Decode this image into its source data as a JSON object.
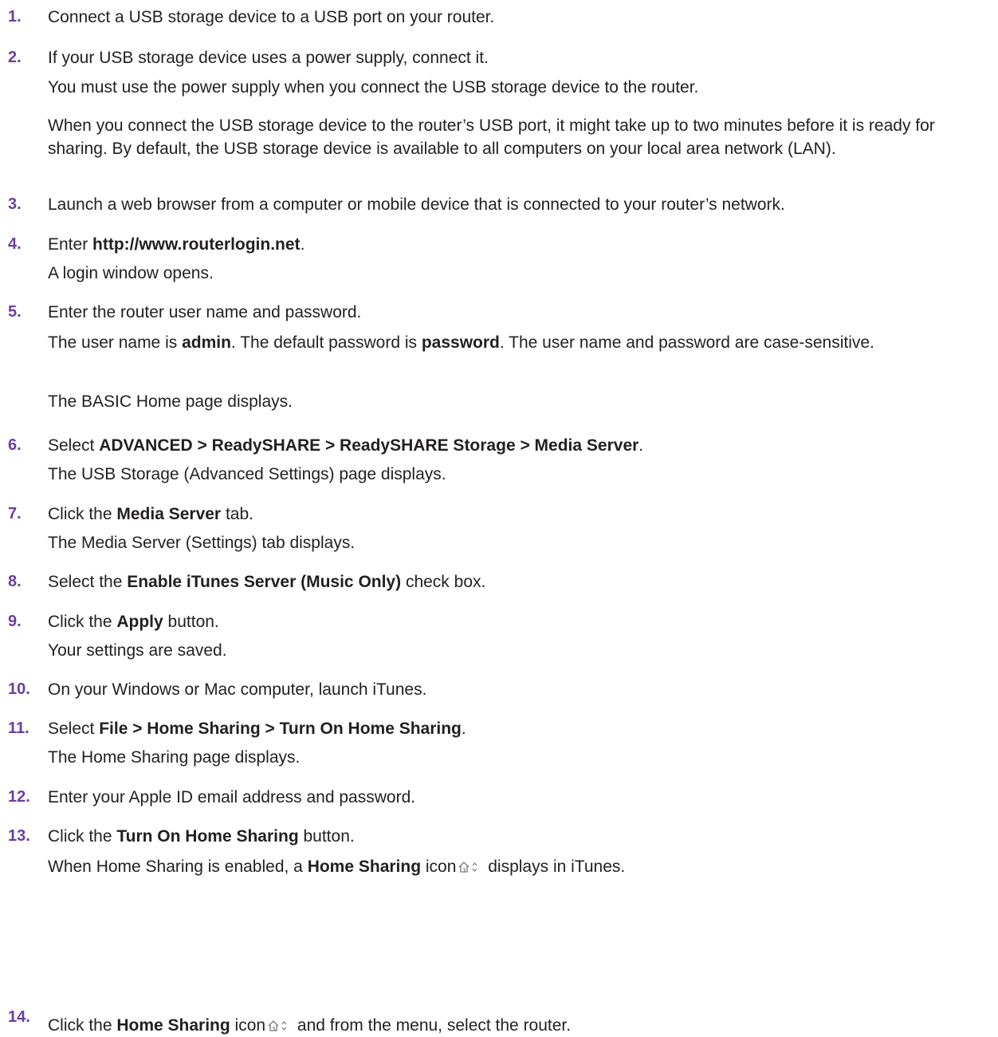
{
  "steps": [
    {
      "number": "1.",
      "text": "Connect a USB storage device to a USB port on your router."
    },
    {
      "number": "2.",
      "text": "If your USB storage device uses a power supply, connect it.",
      "note1": "You must use the power supply when you connect the USB storage device to the router.",
      "note2": "When you connect the USB storage device to the router’s USB port, it might take up to two minutes before it is ready for sharing. By default, the USB storage device is available to all computers on your local area network (LAN)."
    },
    {
      "number": "3.",
      "text": "Launch a web browser from a computer or mobile device that is connected to your router’s network."
    },
    {
      "number": "4.",
      "text_pre": "Enter ",
      "text_bold": "http://www.routerlogin.net",
      "text_post": ".",
      "note1": "A login window opens."
    },
    {
      "number": "5.",
      "text": "Enter the router user name and password.",
      "note1_a": "The user name is ",
      "note1_b": "admin",
      "note1_c": ". The default password is ",
      "note1_d": "password",
      "note1_e": ". The user name and password are case-sensitive.",
      "note2": "The BASIC Home page displays."
    },
    {
      "number": "6.",
      "text_pre": "Select ",
      "text_bold": "ADVANCED > ReadySHARE > ReadySHARE Storage > Media Server",
      "text_post": ".",
      "note1": "The USB Storage (Advanced Settings) page displays."
    },
    {
      "number": "7.",
      "text_pre": "Click the ",
      "text_bold": "Media Server",
      "text_post": " tab.",
      "note1": "The Media Server (Settings) tab displays."
    },
    {
      "number": "8.",
      "text_pre": "Select the ",
      "text_bold": "Enable iTunes Server (Music Only)",
      "text_post": " check box."
    },
    {
      "number": "9.",
      "text_pre": "Click the ",
      "text_bold": "Apply",
      "text_post": " button.",
      "note1": "Your settings are saved."
    },
    {
      "number": "10.",
      "text": "On your Windows or Mac computer, launch iTunes."
    },
    {
      "number": "11.",
      "text_pre": "Select ",
      "text_bold": "File > Home Sharing > Turn On Home Sharing",
      "text_post": ".",
      "note1": "The Home Sharing page displays."
    },
    {
      "number": "12.",
      "text": "Enter your Apple ID email address and password."
    },
    {
      "number": "13.",
      "text_pre": "Click the ",
      "text_bold": "Turn On Home Sharing",
      "text_post": " button.",
      "note1_a": "When Home Sharing is enabled, a ",
      "note1_b": "Home Sharing",
      "note1_c": " icon",
      "note1_d": " displays in iTunes."
    },
    {
      "number": "14.",
      "text_pre": "Click the ",
      "text_bold": "Home Sharing",
      "text_mid": " icon",
      "text_post": " and from the menu, select the router."
    }
  ],
  "icons": {
    "home_sharing": "home-sharing-icon"
  },
  "colors": {
    "step_number": "#6a3fa0",
    "body_text": "#231f20"
  }
}
